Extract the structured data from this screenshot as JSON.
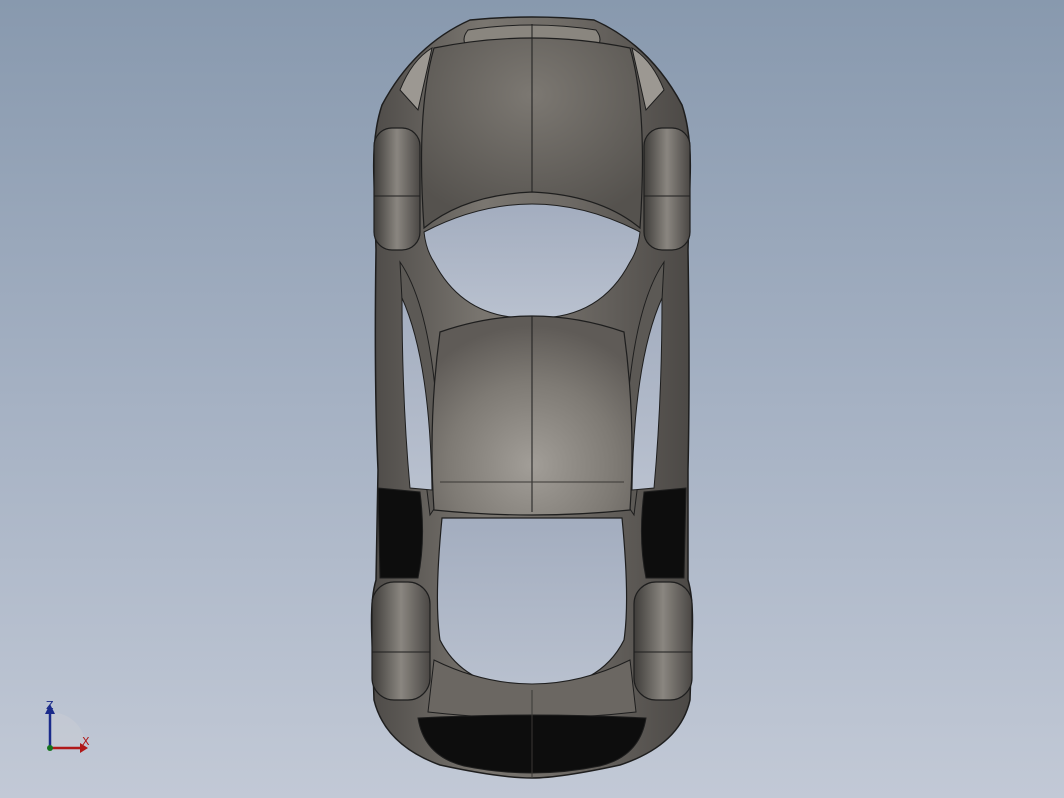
{
  "viewport": {
    "background_top": "#8899ae",
    "background_bottom": "#c2c9d6"
  },
  "model": {
    "body_color": "#6f6b66",
    "body_highlight": "#8c8882",
    "glass_color": "#adb6c6",
    "dark_color": "#0d0d0d",
    "edge_color": "#1e1e1e"
  },
  "triad": {
    "z_label": "Z",
    "x_label": "X",
    "z_color": "#1a2a8a",
    "x_color": "#b01818"
  }
}
